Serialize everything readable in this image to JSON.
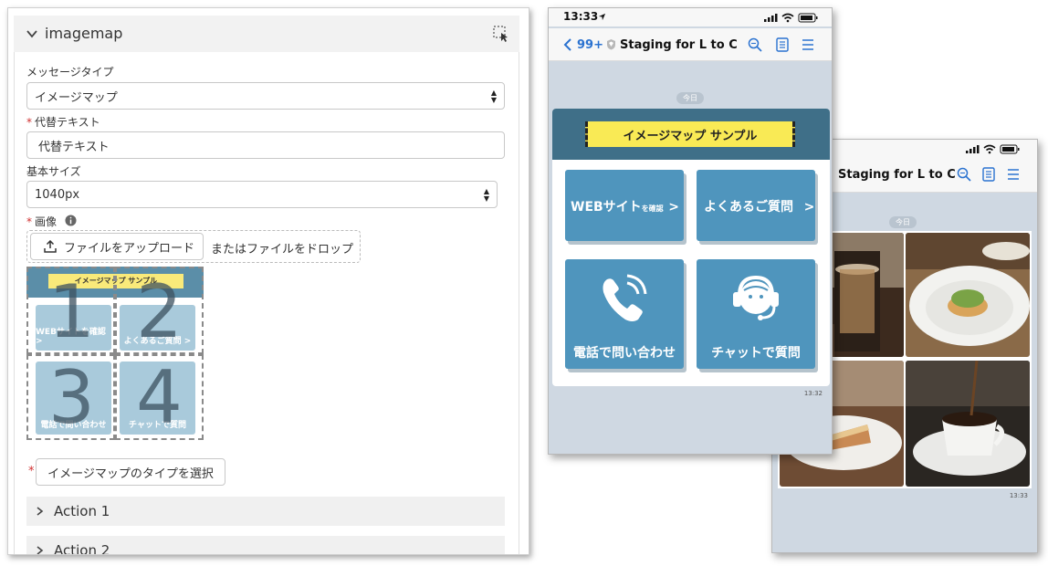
{
  "panel": {
    "title": "imagemap",
    "message_type_label": "メッセージタイプ",
    "message_type_value": "イメージマップ",
    "alt_text_label": "代替テキスト",
    "alt_text_value": "代替テキスト",
    "base_size_label": "基本サイズ",
    "base_size_value": "1040px",
    "image_label": "画像",
    "upload_button": "ファイルをアップロード",
    "drop_text": "またはファイルをドロップ",
    "required_mark": "*",
    "select_type_button": "イメージマップのタイプを選択",
    "actions": [
      "Action 1",
      "Action 2"
    ],
    "preview": {
      "banner": "イメージマップ サンプル",
      "tiles": [
        "WEBサイトを確認 >",
        "よくあるご質問 >",
        "電話で問い合わせ",
        "チャットで質問"
      ],
      "region_numbers": [
        "1",
        "2",
        "3",
        "4"
      ]
    }
  },
  "phone_front": {
    "time": "13:33",
    "back_count": "99+",
    "chat_name": "Staging for L to C",
    "date_pill": "今日",
    "banner": "イメージマップ サンプル",
    "tiles": [
      {
        "main": "WEBサイト",
        "small": "を確認",
        "arrow": ">"
      },
      {
        "main": "よくあるご質問",
        "arrow": ">"
      },
      {
        "main": "電話で問い合わせ"
      },
      {
        "main": "チャットで質問"
      }
    ],
    "msg_time": "13:32"
  },
  "phone_back": {
    "chat_name": "Staging for L to C",
    "date_pill": "今日",
    "msg_time": "13:33"
  },
  "colors": {
    "accent_blue": "#2a72d0",
    "tile_blue": "#4f95bd",
    "banner_teal": "#3f6f88",
    "banner_yellow": "#f9ea55",
    "chat_bg": "#cfd8e2"
  }
}
